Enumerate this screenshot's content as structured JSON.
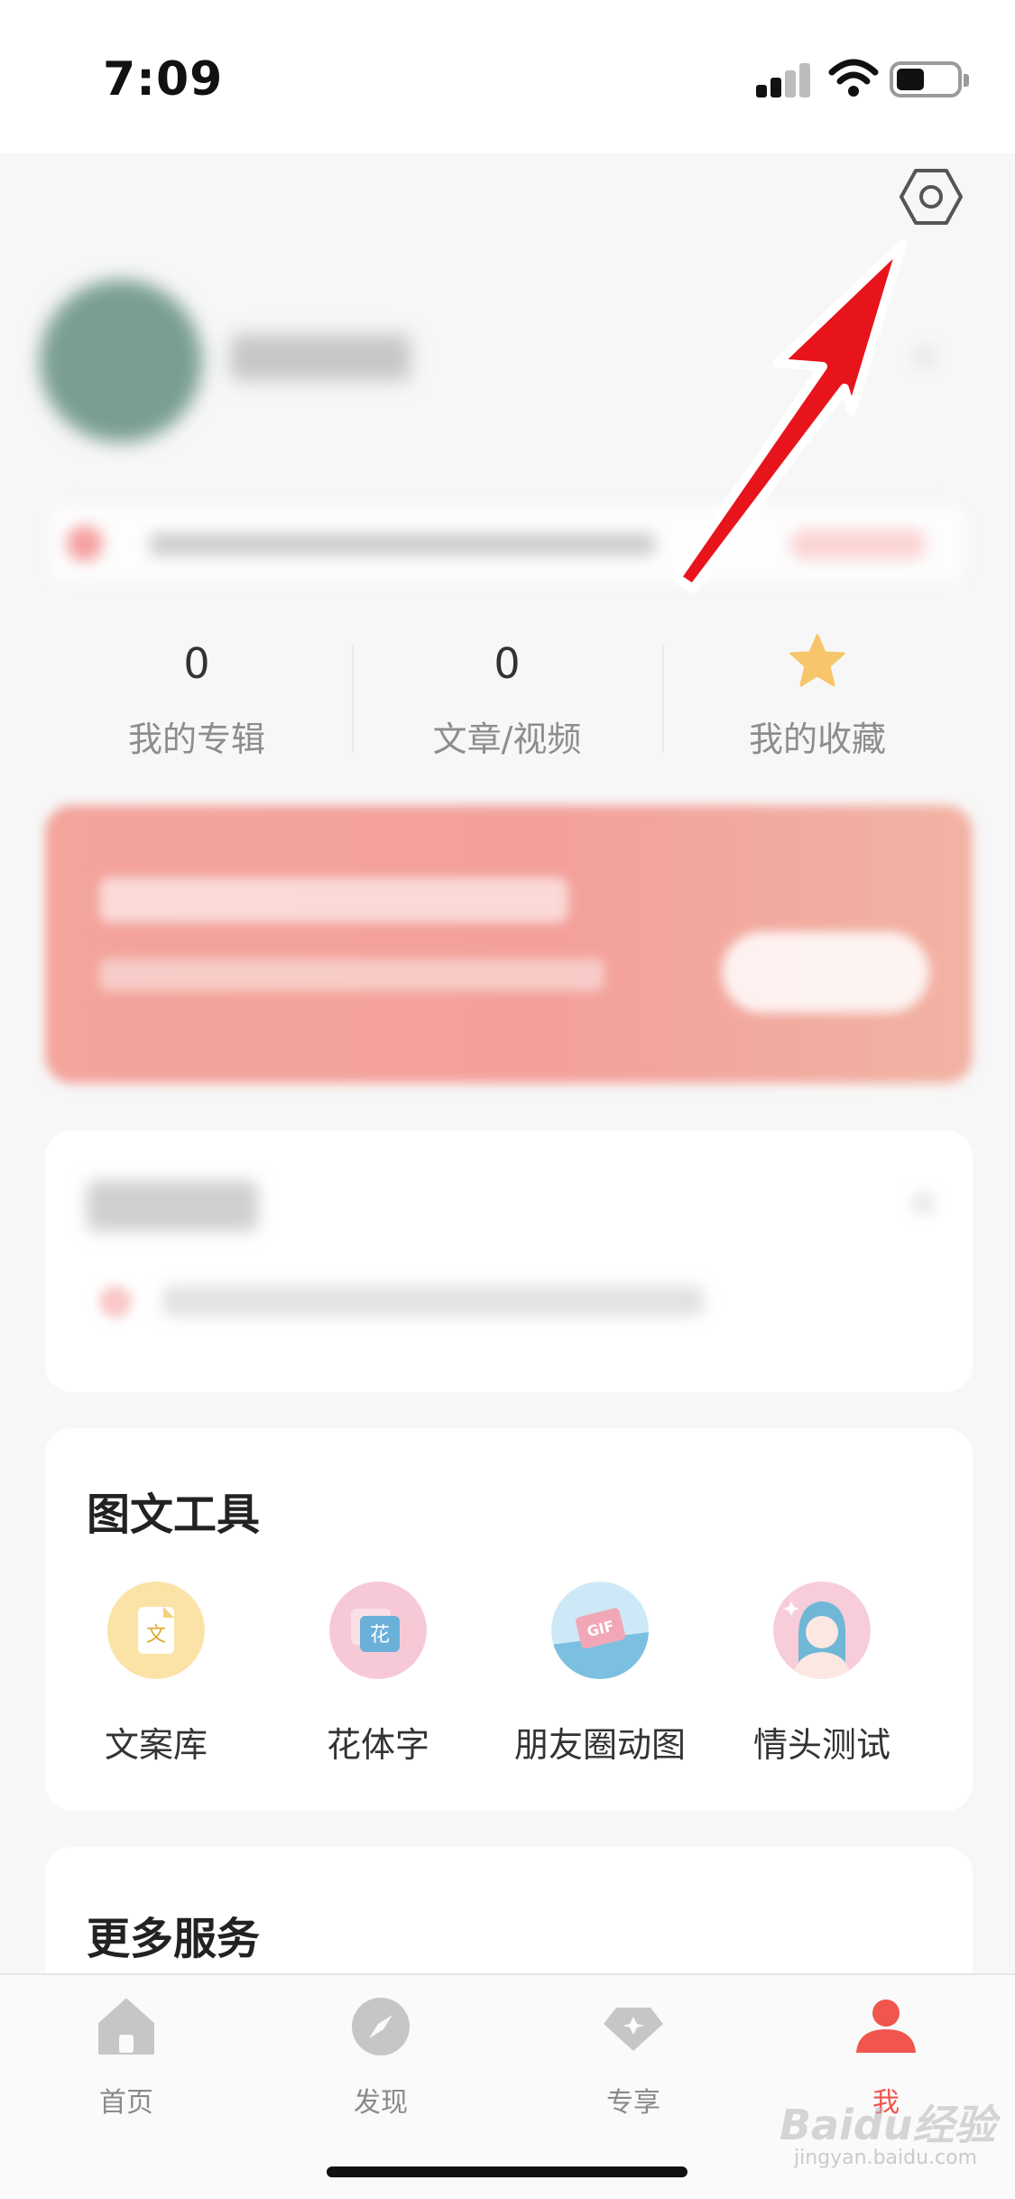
{
  "status_bar": {
    "time": "7:09"
  },
  "stats": [
    {
      "value": "0",
      "label": "我的专辑"
    },
    {
      "value": "0",
      "label": "文章/视频"
    },
    {
      "value": "",
      "label": "我的收藏",
      "icon": "star-icon"
    }
  ],
  "tools_card": {
    "title": "图文工具",
    "items": [
      {
        "label": "文案库",
        "icon": "copy-library-icon",
        "glyph": "文"
      },
      {
        "label": "花体字",
        "icon": "fancy-font-icon",
        "glyph": "花"
      },
      {
        "label": "朋友圈动图",
        "icon": "gif-icon",
        "glyph": "GIF"
      },
      {
        "label": "情头测试",
        "icon": "couple-avatar-icon"
      }
    ]
  },
  "more_card": {
    "title": "更多服务"
  },
  "tabbar": {
    "tabs": [
      {
        "label": "首页",
        "icon": "home-icon"
      },
      {
        "label": "发现",
        "icon": "compass-icon"
      },
      {
        "label": "专享",
        "icon": "diamond-icon"
      },
      {
        "label": "我",
        "icon": "person-icon",
        "active": true
      }
    ]
  },
  "watermark": {
    "text": "Baidu经验",
    "sub": "jingyan.baidu.com"
  },
  "colors": {
    "accent": "#f0564e",
    "star": "#f7c56a",
    "arrow": "#e8141b",
    "banner": "#f3a49b"
  }
}
